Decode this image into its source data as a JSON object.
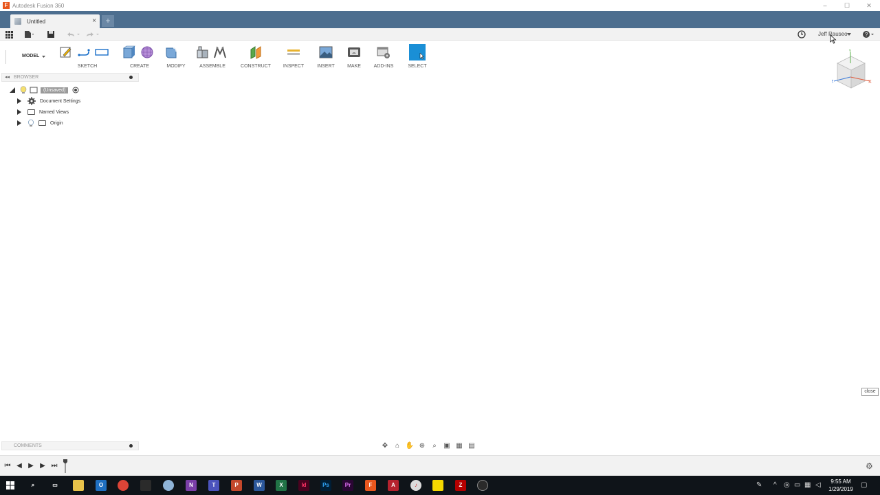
{
  "window": {
    "title": "Autodesk Fusion 360",
    "app_icon": "F"
  },
  "tabs": {
    "active_label": "Untitled",
    "close_glyph": "×",
    "new_glyph": "+"
  },
  "quickbar": {
    "user_name": "Jeff Rauseo"
  },
  "toolbar": {
    "workspace": "MODEL",
    "groups": [
      {
        "label": "SKETCH"
      },
      {
        "label": "CREATE"
      },
      {
        "label": "MODIFY"
      },
      {
        "label": "ASSEMBLE"
      },
      {
        "label": "CONSTRUCT"
      },
      {
        "label": "INSPECT"
      },
      {
        "label": "INSERT"
      },
      {
        "label": "MAKE"
      },
      {
        "label": "ADD-INS"
      },
      {
        "label": "SELECT"
      }
    ]
  },
  "browser": {
    "title": "BROWSER",
    "root_label": "(Unsaved)",
    "items": [
      {
        "label": "Document Settings",
        "icon": "gear-icon"
      },
      {
        "label": "Named Views",
        "icon": "folder-icon"
      },
      {
        "label": "Origin",
        "icon": "folder-icon"
      }
    ]
  },
  "viewcube": {
    "axis_x": "X",
    "axis_y": "Y",
    "axis_z": "Z"
  },
  "comments": {
    "title": "COMMENTS"
  },
  "tooltip": {
    "text": "close"
  },
  "taskbar": {
    "time": "9:55 AM",
    "date": "1/29/2019"
  },
  "colors": {
    "tab_bar": "#4d6e8f",
    "accent_select": "#1a8fd6",
    "taskbar": "#0f1419"
  }
}
